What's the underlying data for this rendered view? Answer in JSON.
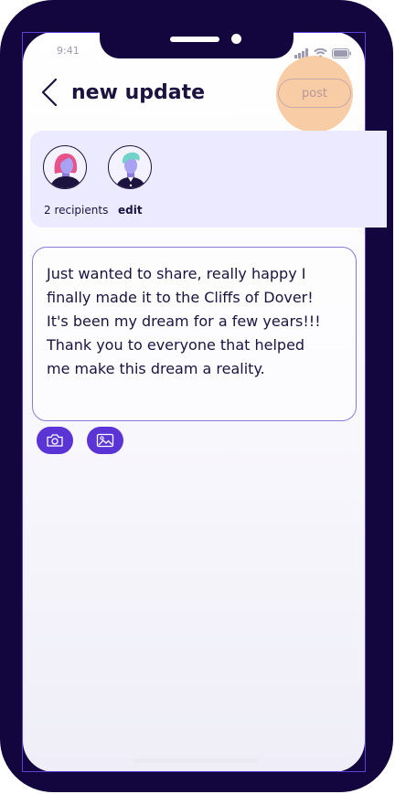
{
  "status_bar": {
    "time": "9:41"
  },
  "header": {
    "title": "new update",
    "post_label": "post"
  },
  "recipients": {
    "count_label": "2 recipients",
    "edit_label": "edit"
  },
  "message": {
    "text": "Just wanted to share, really happy I\nfinally made it to the Cliffs of Dover!\nIt's been my dream for a few years!!!\nThank you to everyone that helped\nme make this dream a reality."
  },
  "icons": {
    "back": "chevron-left-icon",
    "camera": "camera-icon",
    "gallery": "image-icon",
    "signal": "signal-icon",
    "wifi": "wifi-icon",
    "battery": "battery-icon"
  },
  "colors": {
    "frame": "#13063f",
    "accent": "#5b34d6",
    "panel": "#eceaff",
    "highlight": "#f8c9a0"
  }
}
